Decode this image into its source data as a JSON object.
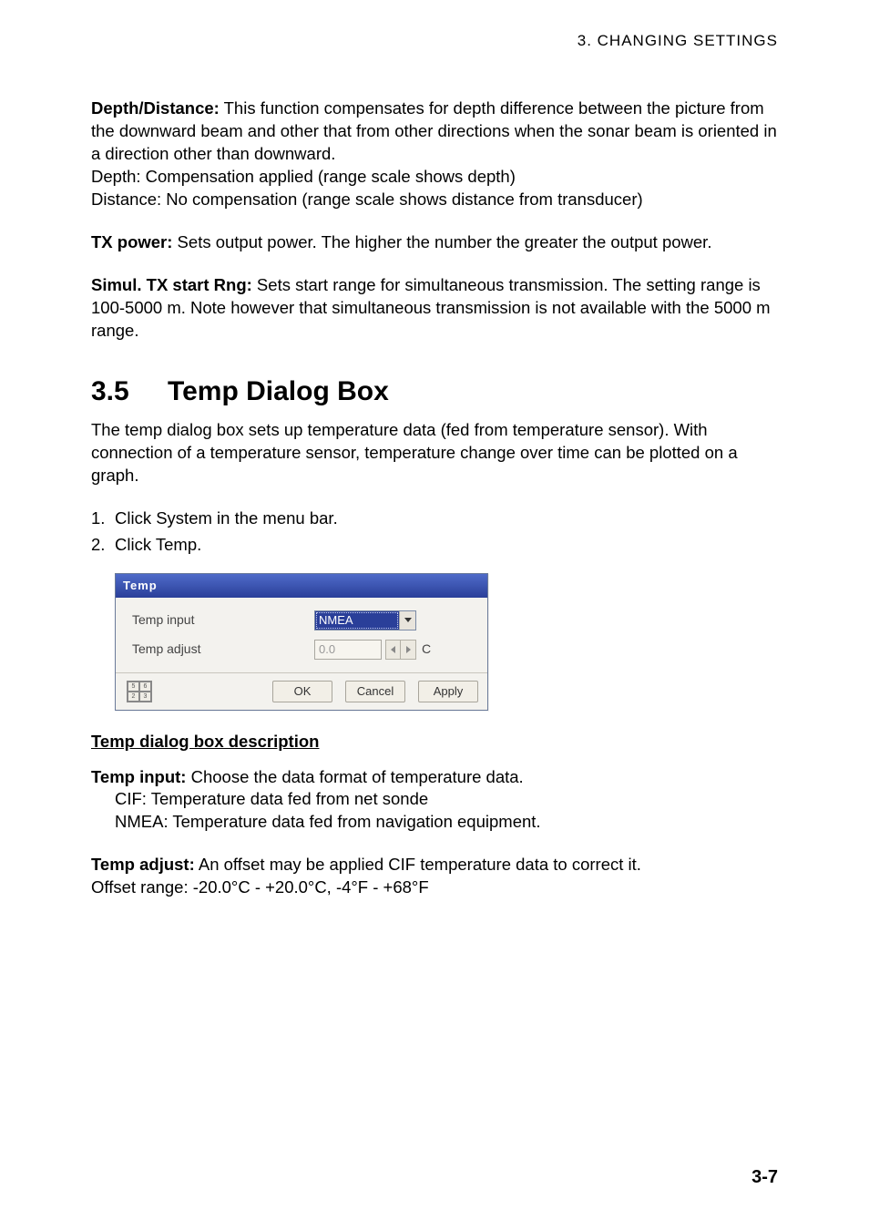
{
  "header": "3.  CHANGING  SETTINGS",
  "p1": {
    "label": "Depth/Distance:",
    "text": " This function compensates for depth difference between the picture from the downward beam and other that from other directions when the sonar beam is oriented in a direction other than downward.",
    "line2": "Depth: Compensation applied (range scale shows depth)",
    "line3": "Distance: No compensation (range scale shows distance from transducer)"
  },
  "p2": {
    "label": "TX power:",
    "text": " Sets output power. The higher the number the greater the output power."
  },
  "p3": {
    "label": "Simul. TX start Rng:",
    "text": " Sets start range for simultaneous transmission. The setting range is 100-5000 m. Note however that simultaneous transmission is not available with the 5000 m range."
  },
  "section": {
    "num": "3.5",
    "title": "Temp Dialog Box"
  },
  "intro": "The temp dialog box sets up temperature data (fed from temperature sensor). With connection of a temperature sensor, temperature change over time can be plotted on a graph.",
  "steps": [
    {
      "n": "1.",
      "t": "Click System in the menu bar."
    },
    {
      "n": "2.",
      "t": "Click Temp."
    }
  ],
  "dialog": {
    "title": "Temp",
    "row1_label": "Temp input",
    "row1_value": "NMEA",
    "row2_label": "Temp adjust",
    "row2_value": "0.0",
    "row2_unit": "C",
    "ok": "OK",
    "cancel": "Cancel",
    "apply": "Apply"
  },
  "subhead": "Temp dialog box description",
  "d1": {
    "label": "Temp input:",
    "text": " Choose the data format of temperature data.",
    "l2": "CIF: Temperature data fed from net sonde",
    "l3": "NMEA: Temperature data fed from navigation equipment."
  },
  "d2": {
    "label": "Temp adjust:",
    "text": " An offset may be applied CIF temperature data to correct it.",
    "l2": "Offset range: -20.0°C - +20.0°C, -4°F - +68°F"
  },
  "pagenum": "3-7"
}
